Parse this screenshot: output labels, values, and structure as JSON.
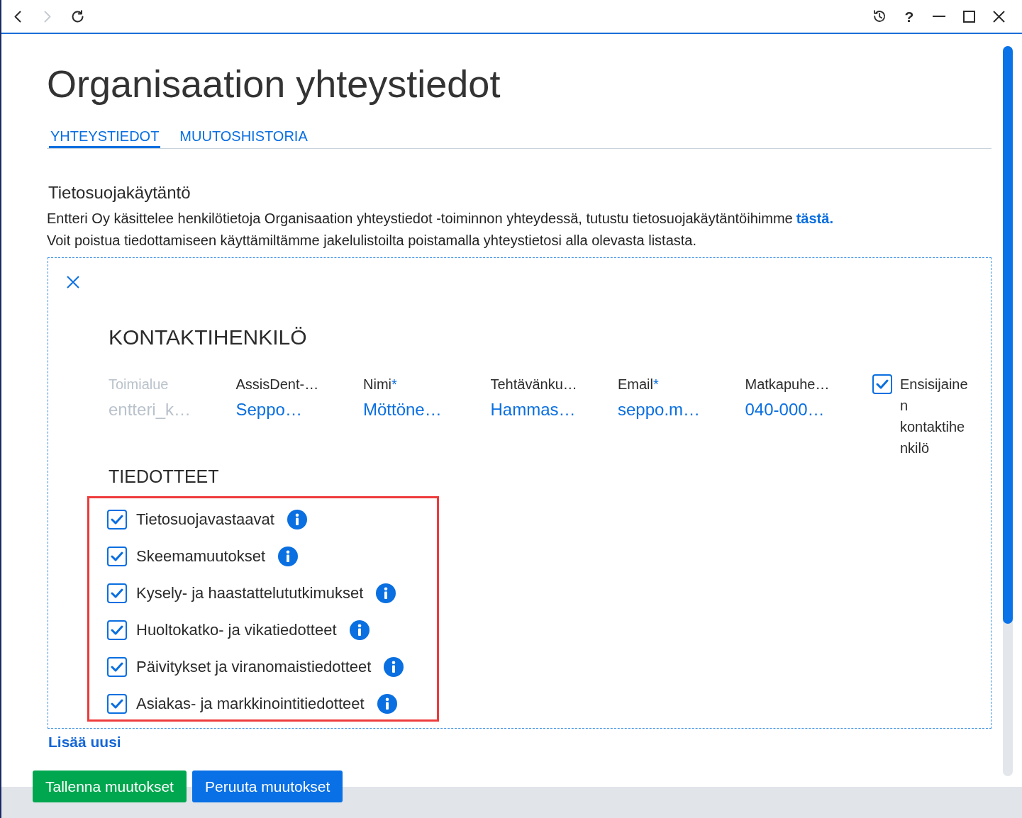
{
  "title_bar": {
    "nav_buttons": [
      {
        "kind": "back",
        "disabled": false
      },
      {
        "kind": "forward",
        "disabled": true
      },
      {
        "kind": "refresh",
        "disabled": false
      }
    ],
    "window_buttons": [
      {
        "kind": "history"
      },
      {
        "kind": "help",
        "label": "?"
      },
      {
        "kind": "minimize"
      },
      {
        "kind": "maximize"
      },
      {
        "kind": "close"
      }
    ]
  },
  "title": "Organisaation yhteystiedot",
  "tabs": [
    {
      "label": "YHTEYSTIEDOT",
      "selected": true
    },
    {
      "label": "MUUTOSHISTORIA",
      "selected": false
    }
  ],
  "privacy": {
    "heading": "Tietosuojakäytäntö",
    "text": "Entteri Oy käsittelee henkilötietoja Organisaation yhteystiedot -toiminnon yhteydessä, tutustu tietosuojakäytäntöihimme",
    "link": "tästä.",
    "note": "Voit poistua tiedottamiseen käyttämiltämme jakelulistoilta poistamalla yhteystietosi alla olevasta listasta."
  },
  "contact": {
    "heading": "KONTAKTIHENKILÖ",
    "fields": [
      {
        "label": "Toimialue",
        "value": "entteri_k…",
        "disabled": true
      },
      {
        "label": "AssisDent-…",
        "value": "Seppo…",
        "disabled": false
      },
      {
        "label": "Nimi",
        "required_mark": "*",
        "value": "Möttöne…",
        "disabled": false
      },
      {
        "label": "Tehtävänku…",
        "value": "Hammas…",
        "disabled": false
      },
      {
        "label": "Email",
        "required_mark": "*",
        "value": "seppo.m…",
        "disabled": false
      },
      {
        "label": "Matkapuhe…",
        "value": "040-000…",
        "disabled": false
      }
    ],
    "primary_contact": {
      "label": "Ensisijainen kontaktihenkilö",
      "checked": true
    },
    "bulletins_heading": "TIEDOTTEET",
    "bulletins": [
      {
        "label": "Tietosuojavastaavat",
        "checked": true
      },
      {
        "label": "Skeemamuutokset",
        "checked": true
      },
      {
        "label": "Kysely- ja haastattelututkimukset",
        "checked": true
      },
      {
        "label": "Huoltokatko- ja vikatiedotteet",
        "checked": true
      },
      {
        "label": "Päivitykset ja viranomaistiedotteet",
        "checked": true
      },
      {
        "label": "Asiakas- ja markkinointitiedotteet",
        "checked": true
      }
    ]
  },
  "add_new": "Lisää uusi",
  "buttons": [
    {
      "label": "Tallenna muutokset",
      "kind": "save"
    },
    {
      "label": "Peruuta muutokset",
      "kind": "cancel"
    }
  ]
}
